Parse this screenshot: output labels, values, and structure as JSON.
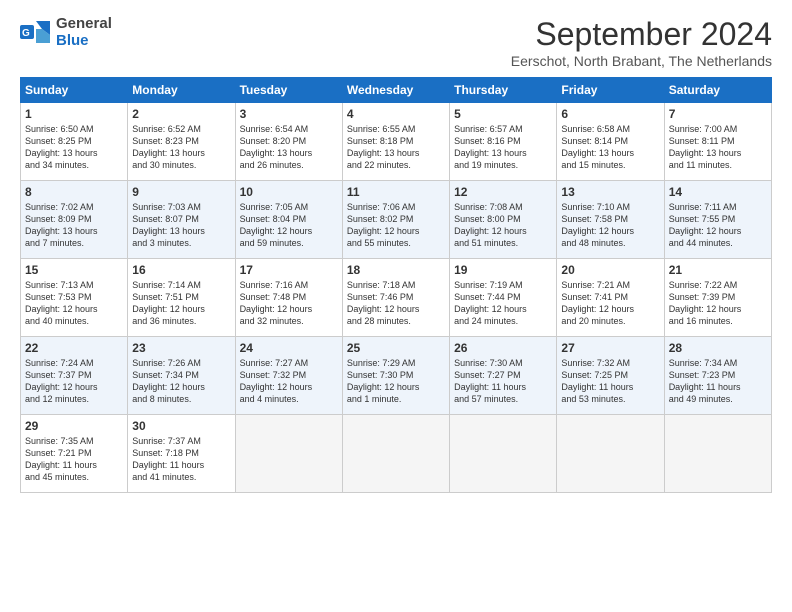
{
  "header": {
    "logo_general": "General",
    "logo_blue": "Blue",
    "month_title": "September 2024",
    "location": "Eerschot, North Brabant, The Netherlands"
  },
  "weekdays": [
    "Sunday",
    "Monday",
    "Tuesday",
    "Wednesday",
    "Thursday",
    "Friday",
    "Saturday"
  ],
  "weeks": [
    [
      {
        "day": "1",
        "lines": [
          "Sunrise: 6:50 AM",
          "Sunset: 8:25 PM",
          "Daylight: 13 hours",
          "and 34 minutes."
        ]
      },
      {
        "day": "2",
        "lines": [
          "Sunrise: 6:52 AM",
          "Sunset: 8:23 PM",
          "Daylight: 13 hours",
          "and 30 minutes."
        ]
      },
      {
        "day": "3",
        "lines": [
          "Sunrise: 6:54 AM",
          "Sunset: 8:20 PM",
          "Daylight: 13 hours",
          "and 26 minutes."
        ]
      },
      {
        "day": "4",
        "lines": [
          "Sunrise: 6:55 AM",
          "Sunset: 8:18 PM",
          "Daylight: 13 hours",
          "and 22 minutes."
        ]
      },
      {
        "day": "5",
        "lines": [
          "Sunrise: 6:57 AM",
          "Sunset: 8:16 PM",
          "Daylight: 13 hours",
          "and 19 minutes."
        ]
      },
      {
        "day": "6",
        "lines": [
          "Sunrise: 6:58 AM",
          "Sunset: 8:14 PM",
          "Daylight: 13 hours",
          "and 15 minutes."
        ]
      },
      {
        "day": "7",
        "lines": [
          "Sunrise: 7:00 AM",
          "Sunset: 8:11 PM",
          "Daylight: 13 hours",
          "and 11 minutes."
        ]
      }
    ],
    [
      {
        "day": "8",
        "lines": [
          "Sunrise: 7:02 AM",
          "Sunset: 8:09 PM",
          "Daylight: 13 hours",
          "and 7 minutes."
        ]
      },
      {
        "day": "9",
        "lines": [
          "Sunrise: 7:03 AM",
          "Sunset: 8:07 PM",
          "Daylight: 13 hours",
          "and 3 minutes."
        ]
      },
      {
        "day": "10",
        "lines": [
          "Sunrise: 7:05 AM",
          "Sunset: 8:04 PM",
          "Daylight: 12 hours",
          "and 59 minutes."
        ]
      },
      {
        "day": "11",
        "lines": [
          "Sunrise: 7:06 AM",
          "Sunset: 8:02 PM",
          "Daylight: 12 hours",
          "and 55 minutes."
        ]
      },
      {
        "day": "12",
        "lines": [
          "Sunrise: 7:08 AM",
          "Sunset: 8:00 PM",
          "Daylight: 12 hours",
          "and 51 minutes."
        ]
      },
      {
        "day": "13",
        "lines": [
          "Sunrise: 7:10 AM",
          "Sunset: 7:58 PM",
          "Daylight: 12 hours",
          "and 48 minutes."
        ]
      },
      {
        "day": "14",
        "lines": [
          "Sunrise: 7:11 AM",
          "Sunset: 7:55 PM",
          "Daylight: 12 hours",
          "and 44 minutes."
        ]
      }
    ],
    [
      {
        "day": "15",
        "lines": [
          "Sunrise: 7:13 AM",
          "Sunset: 7:53 PM",
          "Daylight: 12 hours",
          "and 40 minutes."
        ]
      },
      {
        "day": "16",
        "lines": [
          "Sunrise: 7:14 AM",
          "Sunset: 7:51 PM",
          "Daylight: 12 hours",
          "and 36 minutes."
        ]
      },
      {
        "day": "17",
        "lines": [
          "Sunrise: 7:16 AM",
          "Sunset: 7:48 PM",
          "Daylight: 12 hours",
          "and 32 minutes."
        ]
      },
      {
        "day": "18",
        "lines": [
          "Sunrise: 7:18 AM",
          "Sunset: 7:46 PM",
          "Daylight: 12 hours",
          "and 28 minutes."
        ]
      },
      {
        "day": "19",
        "lines": [
          "Sunrise: 7:19 AM",
          "Sunset: 7:44 PM",
          "Daylight: 12 hours",
          "and 24 minutes."
        ]
      },
      {
        "day": "20",
        "lines": [
          "Sunrise: 7:21 AM",
          "Sunset: 7:41 PM",
          "Daylight: 12 hours",
          "and 20 minutes."
        ]
      },
      {
        "day": "21",
        "lines": [
          "Sunrise: 7:22 AM",
          "Sunset: 7:39 PM",
          "Daylight: 12 hours",
          "and 16 minutes."
        ]
      }
    ],
    [
      {
        "day": "22",
        "lines": [
          "Sunrise: 7:24 AM",
          "Sunset: 7:37 PM",
          "Daylight: 12 hours",
          "and 12 minutes."
        ]
      },
      {
        "day": "23",
        "lines": [
          "Sunrise: 7:26 AM",
          "Sunset: 7:34 PM",
          "Daylight: 12 hours",
          "and 8 minutes."
        ]
      },
      {
        "day": "24",
        "lines": [
          "Sunrise: 7:27 AM",
          "Sunset: 7:32 PM",
          "Daylight: 12 hours",
          "and 4 minutes."
        ]
      },
      {
        "day": "25",
        "lines": [
          "Sunrise: 7:29 AM",
          "Sunset: 7:30 PM",
          "Daylight: 12 hours",
          "and 1 minute."
        ]
      },
      {
        "day": "26",
        "lines": [
          "Sunrise: 7:30 AM",
          "Sunset: 7:27 PM",
          "Daylight: 11 hours",
          "and 57 minutes."
        ]
      },
      {
        "day": "27",
        "lines": [
          "Sunrise: 7:32 AM",
          "Sunset: 7:25 PM",
          "Daylight: 11 hours",
          "and 53 minutes."
        ]
      },
      {
        "day": "28",
        "lines": [
          "Sunrise: 7:34 AM",
          "Sunset: 7:23 PM",
          "Daylight: 11 hours",
          "and 49 minutes."
        ]
      }
    ],
    [
      {
        "day": "29",
        "lines": [
          "Sunrise: 7:35 AM",
          "Sunset: 7:21 PM",
          "Daylight: 11 hours",
          "and 45 minutes."
        ]
      },
      {
        "day": "30",
        "lines": [
          "Sunrise: 7:37 AM",
          "Sunset: 7:18 PM",
          "Daylight: 11 hours",
          "and 41 minutes."
        ]
      },
      {
        "day": "",
        "lines": []
      },
      {
        "day": "",
        "lines": []
      },
      {
        "day": "",
        "lines": []
      },
      {
        "day": "",
        "lines": []
      },
      {
        "day": "",
        "lines": []
      }
    ]
  ]
}
